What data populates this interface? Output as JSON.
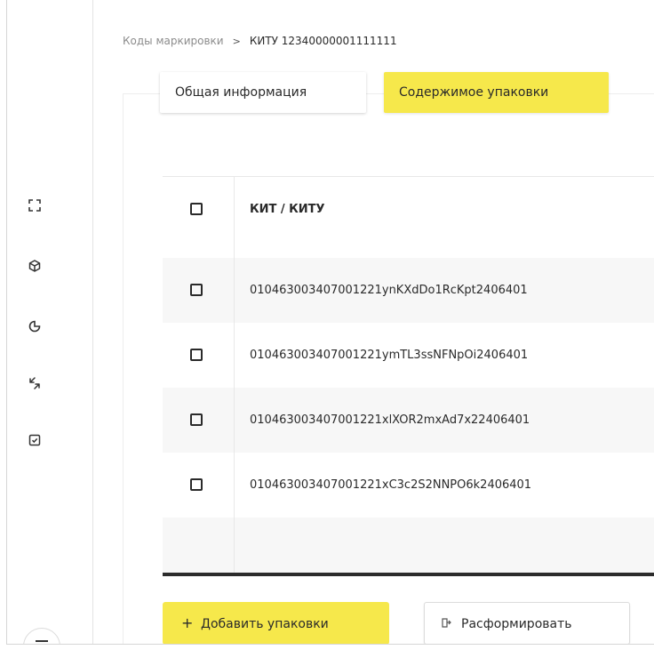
{
  "breadcrumb": {
    "parent": "Коды маркировки",
    "separator": ">",
    "current": "КИТУ 12340000001111111"
  },
  "tabs": [
    {
      "label": "Общая информация",
      "active": false
    },
    {
      "label": "Содержимое упаковки",
      "active": true
    }
  ],
  "sidebar": {
    "icons": [
      "scan-icon",
      "box-icon",
      "pie-chart-icon",
      "transfer-icon",
      "checkbox-icon",
      "menu-icon"
    ]
  },
  "table": {
    "header": "КИТ / КИТУ",
    "rows": [
      "010463003407001221ynKXdDo1RcKpt2406401",
      "010463003407001221ymTL3ssNFNpOi2406401",
      "010463003407001221xlXOR2mxAd7x22406401",
      "010463003407001221xC3c2S2NNPO6k2406401"
    ]
  },
  "actions": {
    "add_label": "Добавить упаковки",
    "add_icon": "+",
    "disband_label": "Расформировать",
    "disband_icon": "disband-icon"
  },
  "colors": {
    "accent": "#f6e84b",
    "text": "#2a2a2a",
    "row_shade": "#f7f7f7"
  }
}
